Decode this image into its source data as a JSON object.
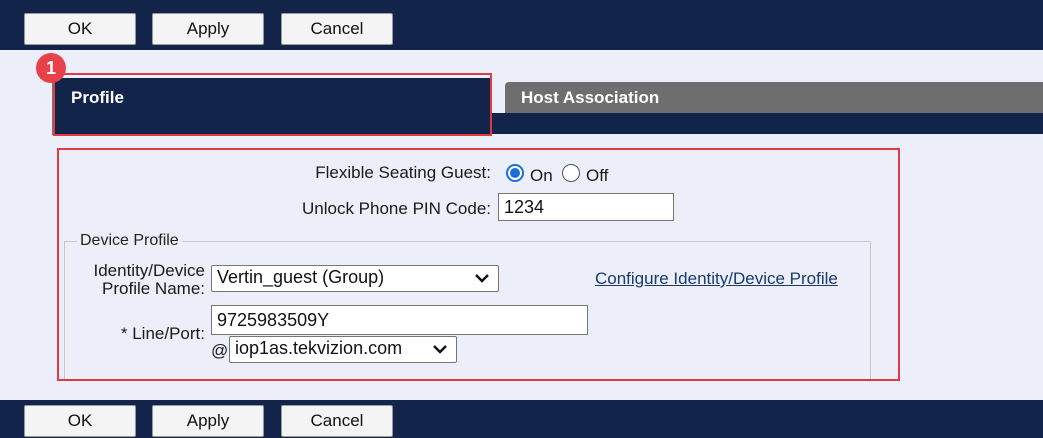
{
  "toolbar": {
    "ok_label": "OK",
    "apply_label": "Apply",
    "cancel_label": "Cancel"
  },
  "annotation": {
    "badge_number": "1",
    "highlight_color": "#e03b43"
  },
  "tabs": [
    {
      "label": "Profile",
      "selected": true
    },
    {
      "label": "Host Association",
      "selected": false
    }
  ],
  "form": {
    "flexible_seating_label": "Flexible Seating Guest:",
    "radio_on_label": "On",
    "radio_off_label": "Off",
    "radio_selected": "On",
    "pin_label": "Unlock Phone PIN Code:",
    "pin_value": "1234",
    "device_profile": {
      "legend": "Device Profile",
      "identity_label_line1": "Identity/Device",
      "identity_label_line2": "Profile Name:",
      "identity_selected": "Vertin_guest (Group)",
      "configure_link": "Configure Identity/Device Profile",
      "line_port_label": "* Line/Port:",
      "line_port_value": "9725983509Y",
      "at_sign": "@",
      "domain_selected": "iop1as.tekvizion.com"
    }
  },
  "colors": {
    "nav_bg": "#13244a",
    "inactive_tab": "#6e6e6e",
    "page_bg": "#eceff9",
    "radio_accent": "#1a6ed8"
  }
}
